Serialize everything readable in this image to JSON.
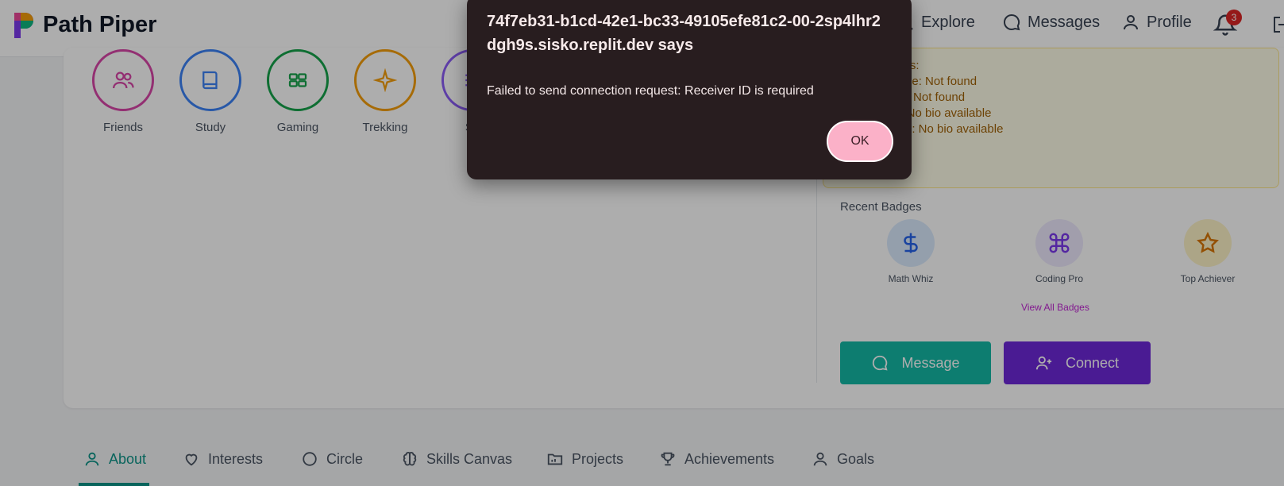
{
  "header": {
    "brand": "Path Piper",
    "nav": [
      {
        "label": "Explore",
        "icon": "search-icon"
      },
      {
        "label": "Messages",
        "icon": "message-icon"
      },
      {
        "label": "Profile",
        "icon": "user-icon"
      }
    ],
    "notification_count": "3"
  },
  "circles": [
    {
      "label": "Friends",
      "color": "#d946a8",
      "icon": "users-icon"
    },
    {
      "label": "Study",
      "color": "#3b82f6",
      "icon": "book-icon"
    },
    {
      "label": "Gaming",
      "color": "#16a34a",
      "icon": "grid-icon"
    },
    {
      "label": "Trekking",
      "color": "#f59e0b",
      "icon": "sparkle-icon"
    },
    {
      "label": "So",
      "color": "#8b5cf6",
      "icon": "list-icon"
    }
  ],
  "warning": {
    "lines": [
      "rces:",
      "gline: Not found",
      "ne: Not found",
      "o: No bio available",
      "line: No bio available",
      "o"
    ]
  },
  "recent_badges": {
    "title": "Recent Badges",
    "items": [
      {
        "label": "Math Whiz",
        "icon": "dollar-icon",
        "color": "#2563eb",
        "bg": "#dbeafe"
      },
      {
        "label": "Coding Pro",
        "icon": "command-icon",
        "color": "#7c3aed",
        "bg": "#ede9fe"
      },
      {
        "label": "Top Achiever",
        "icon": "star-icon",
        "color": "#d97706",
        "bg": "#fef3c7"
      }
    ],
    "view_all": "View All Badges"
  },
  "actions": {
    "message": "Message",
    "connect": "Connect"
  },
  "tabs": [
    {
      "label": "About",
      "icon": "user-icon",
      "active": true
    },
    {
      "label": "Interests",
      "icon": "heart-icon"
    },
    {
      "label": "Circle",
      "icon": "circle-icon"
    },
    {
      "label": "Skills Canvas",
      "icon": "brain-icon"
    },
    {
      "label": "Projects",
      "icon": "folder-icon"
    },
    {
      "label": "Achievements",
      "icon": "trophy-icon"
    },
    {
      "label": "Goals",
      "icon": "user-icon"
    }
  ],
  "dialog": {
    "title": "74f7eb31-b1cd-42e1-bc33-49105efe81c2-00-2sp4lhr2dgh9s.sisko.replit.dev says",
    "message": "Failed to send connection request: Receiver ID is required",
    "ok_label": "OK"
  },
  "colors": {
    "teal": "#14b8a6",
    "purple": "#6d28d9",
    "dialog_bg": "#281d1f",
    "ok_button": "#fbb1c8"
  }
}
